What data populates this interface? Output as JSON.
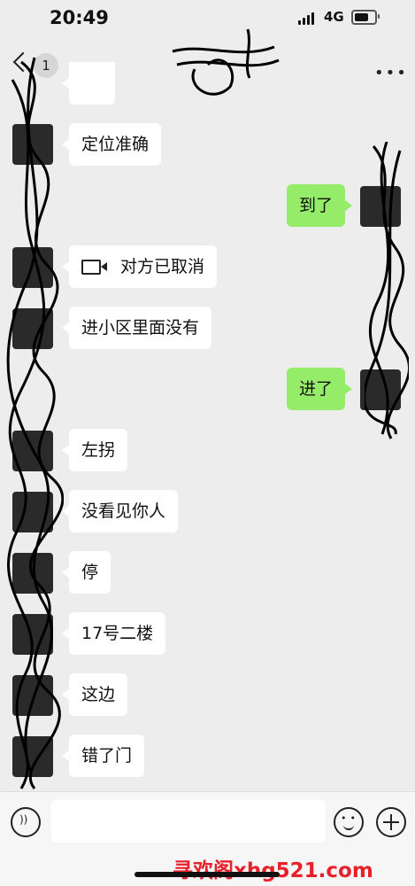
{
  "status_bar": {
    "time": "20:49",
    "network": "4G"
  },
  "nav": {
    "back_count": "1",
    "title": ""
  },
  "messages": [
    {
      "side": "left",
      "text": "定位准确"
    },
    {
      "side": "right",
      "text": "到了"
    },
    {
      "side": "left",
      "text": "对方已取消",
      "icon": "video-call-icon"
    },
    {
      "side": "left",
      "text": "进小区里面没有"
    },
    {
      "side": "right",
      "text": "进了"
    },
    {
      "side": "left",
      "text": "左拐"
    },
    {
      "side": "left",
      "text": "没看见你人"
    },
    {
      "side": "left",
      "text": "停"
    },
    {
      "side": "left",
      "text": "17号二楼"
    },
    {
      "side": "left",
      "text": "这边"
    },
    {
      "side": "left",
      "text": "错了门"
    }
  ],
  "input_bar": {
    "placeholder": ""
  },
  "watermark": "寻欢阁xhg521.com",
  "colors": {
    "bubble_self": "#95ec69",
    "bubble_other": "#ffffff",
    "background": "#ededed"
  }
}
